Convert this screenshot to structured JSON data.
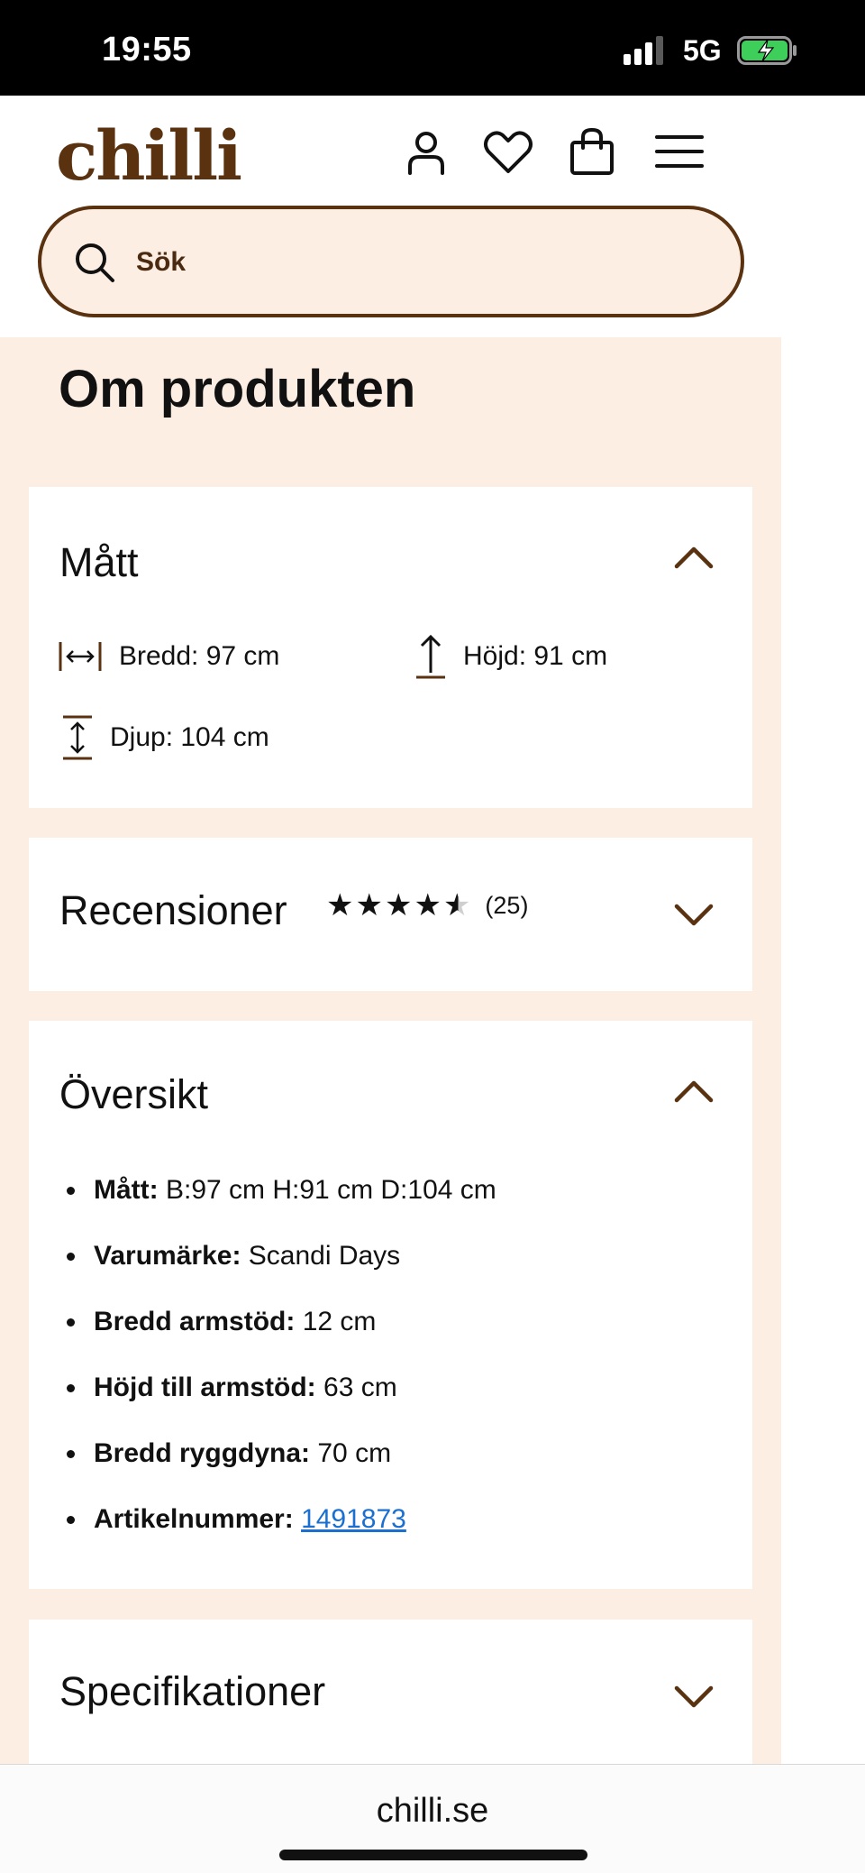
{
  "status_bar": {
    "time": "19:55",
    "network": "5G",
    "battery_charging": true,
    "icons": [
      "signal-icon",
      "battery-icon"
    ]
  },
  "header": {
    "logo": "chilli",
    "brand_color": "#5a3210",
    "icons": [
      "account-icon",
      "heart-icon",
      "shopping-bag-icon",
      "menu-icon"
    ],
    "search": {
      "placeholder": "Sök"
    }
  },
  "main": {
    "title": "Om produkten",
    "background_color": "#fdeee3",
    "sections": {
      "matt": {
        "title": "Mått",
        "expanded": true,
        "dimensions": {
          "width": "Bredd: 97 cm",
          "height": "Höjd: 91 cm",
          "depth": "Djup: 104 cm"
        }
      },
      "reviews": {
        "title": "Recensioner",
        "expanded": false,
        "rating": 4.5,
        "rating_max": 5,
        "count": "(25)"
      },
      "overview": {
        "title": "Översikt",
        "expanded": true,
        "items": [
          {
            "label": "Mått:",
            "value": " B:97 cm H:91 cm D:104 cm"
          },
          {
            "label": "Varumärke:",
            "value": " Scandi Days"
          },
          {
            "label": "Bredd armstöd:",
            "value": " 12 cm"
          },
          {
            "label": "Höjd till armstöd:",
            "value": " 63 cm"
          },
          {
            "label": "Bredd ryggdyna:",
            "value": " 70 cm"
          },
          {
            "label": "Artikelnummer:",
            "value": "1491873",
            "link": true
          }
        ]
      },
      "specifications": {
        "title": "Specifikationer",
        "expanded": false
      }
    }
  },
  "browser": {
    "url": "chilli.se"
  }
}
